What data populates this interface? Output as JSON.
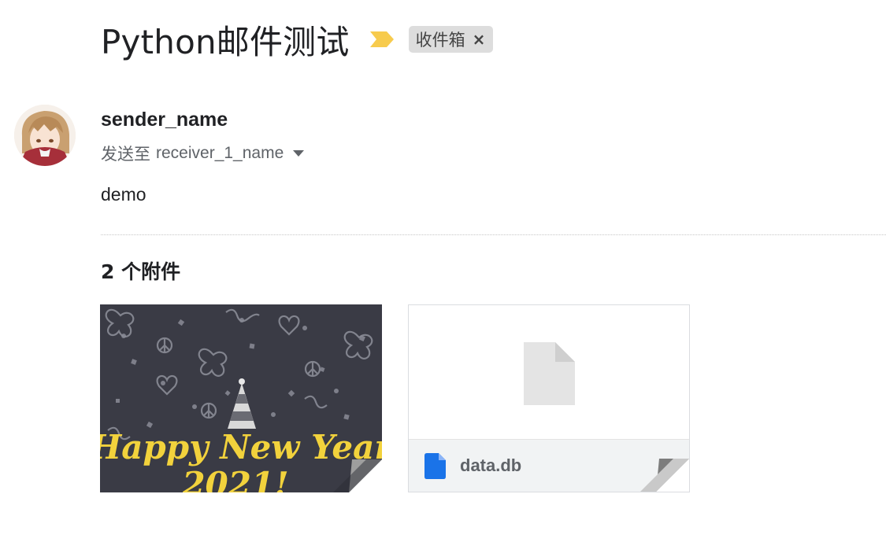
{
  "email": {
    "subject": "Python邮件测试",
    "label": "收件箱",
    "label_close": "×",
    "sender": "sender_name",
    "to_prefix": "发送至",
    "recipient": "receiver_1_name",
    "body": "demo"
  },
  "attachments": {
    "count_label": "2 个附件",
    "items": [
      {
        "type": "image",
        "thumbnail_text": [
          "Happy New Year",
          "2021!"
        ]
      },
      {
        "type": "file",
        "name": "data.db"
      }
    ]
  },
  "colors": {
    "importance_marker": "#f7cb4d",
    "file_icon": "#1a73e8",
    "thumb_bg": "#3a3b45",
    "thumb_text": "#f2d23c"
  },
  "icons": [
    "importance-marker-icon",
    "chip-close-icon",
    "dropdown-caret-icon",
    "generic-file-icon",
    "doc-file-icon",
    "page-fold-icon"
  ]
}
